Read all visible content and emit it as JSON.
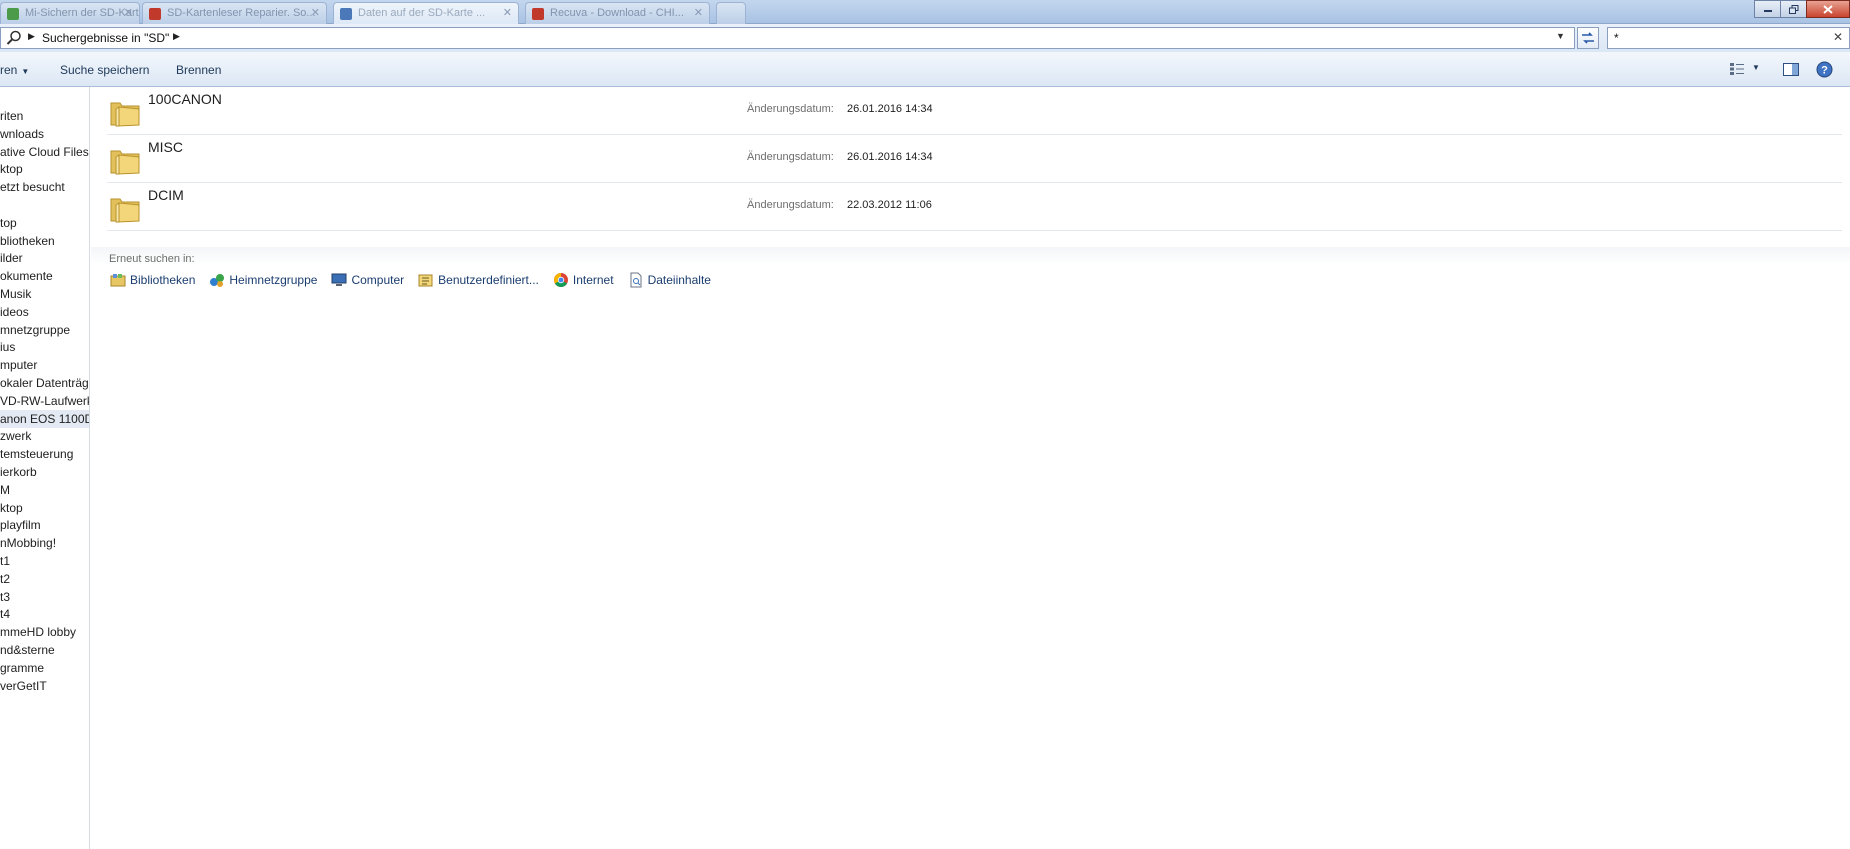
{
  "tabs": [
    {
      "label": "Mi-Sichern der SD-Karte ...",
      "favicon_color": "#4b9b4b"
    },
    {
      "label": "SD-Kartenleser Reparier. So...",
      "favicon_color": "#c0392b"
    },
    {
      "label": "Daten auf der SD-Karte ...",
      "favicon_color": "#4a78b8"
    },
    {
      "label": "Recuva - Download - CHI...",
      "favicon_color": "#c0392b"
    }
  ],
  "address": {
    "breadcrumb": "Suchergebnisse in \"SD\""
  },
  "search": {
    "value": "*"
  },
  "toolbar": {
    "organize_label": "ren",
    "save_search_label": "Suche speichern",
    "burn_label": "Brennen"
  },
  "nav": {
    "items": [
      "riten",
      "wnloads",
      "ative Cloud Files",
      "ktop",
      "etzt besucht",
      "",
      "top",
      "bliotheken",
      "ilder",
      "okumente",
      "Musik",
      "ideos",
      "mnetzgruppe",
      "ius",
      "mputer",
      "okaler Datenträge",
      "VD-RW-Laufwerk",
      "anon EOS 1100D",
      "zwerk",
      "temsteuerung",
      "ierkorb",
      "M",
      "ktop",
      "playfilm",
      "nMobbing!",
      "t1",
      "t2",
      "t3",
      "t4",
      "mmeHD lobby",
      "nd&sterne",
      "gramme",
      "verGetIT"
    ],
    "selected_index": 17
  },
  "results": [
    {
      "name": "100CANON",
      "date_label": "Änderungsdatum:",
      "date": "26.01.2016 14:34"
    },
    {
      "name": "MISC",
      "date_label": "Änderungsdatum:",
      "date": "26.01.2016 14:34"
    },
    {
      "name": "DCIM",
      "date_label": "Änderungsdatum:",
      "date": "22.03.2012 11:06"
    }
  ],
  "search_again": {
    "label": "Erneut suchen in:",
    "links": [
      "Bibliotheken",
      "Heimnetzgruppe",
      "Computer",
      "Benutzerdefiniert...",
      "Internet",
      "Dateiinhalte"
    ]
  }
}
